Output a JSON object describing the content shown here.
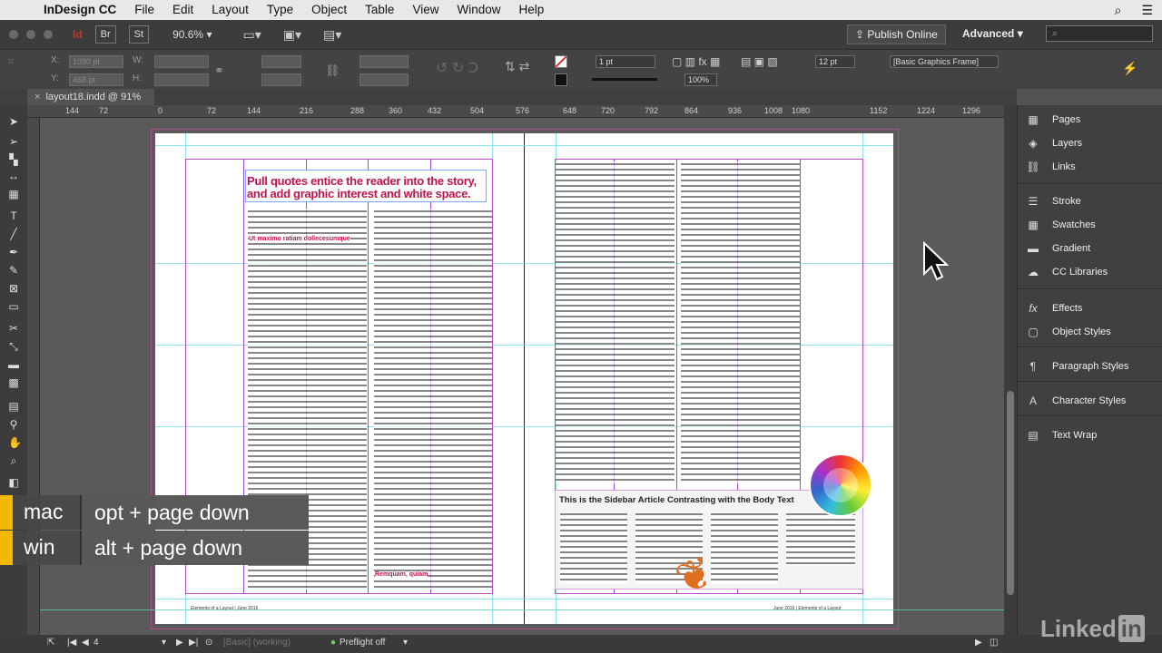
{
  "menubar": {
    "app_name": "InDesign CC",
    "items": [
      "File",
      "Edit",
      "Layout",
      "Type",
      "Object",
      "Table",
      "View",
      "Window",
      "Help"
    ]
  },
  "appbar": {
    "br_label": "Br",
    "st_label": "St",
    "zoom": "90.6%",
    "publish_label": "Publish Online",
    "workspace_label": "Advanced"
  },
  "control": {
    "x_value": "1090 pt",
    "y_value": "468 pt",
    "stroke_weight": "1 pt",
    "zoom_percent": "100%",
    "size_value": "12 pt",
    "frame_style": "[Basic Graphics Frame]"
  },
  "document": {
    "tab_title": "layout18.indd @ 91%"
  },
  "ruler": {
    "ticks": [
      "144",
      "72",
      "0",
      "72",
      "144",
      "216",
      "288",
      "360",
      "432",
      "504",
      "576",
      "648",
      "720",
      "792",
      "864",
      "936",
      "1008",
      "1080",
      "1152",
      "1224",
      "1296"
    ]
  },
  "spread": {
    "pull_quote": "Pull quotes entice the reader into the story, and add graphic interest and white space.",
    "subhead_1": "Ut maximo ratiam dollecesumque",
    "subhead_2": "Remquam, quiam",
    "sidebar_title": "This is the Sidebar Article Contrasting with the Body Text",
    "footer_left": "Elements of a Layout | June 2016",
    "footer_right": "June 2016 | Elements of a Layout"
  },
  "panels": {
    "items": [
      "Pages",
      "Layers",
      "Links",
      "Stroke",
      "Swatches",
      "Gradient",
      "CC Libraries",
      "Effects",
      "Object Styles",
      "Paragraph Styles",
      "Character Styles",
      "Text Wrap"
    ]
  },
  "statusbar": {
    "page_number": "4",
    "style_label": "[Basic] (working)",
    "preflight": "Preflight off"
  },
  "shortcuts": [
    {
      "os": "mac",
      "keys": "opt + page down"
    },
    {
      "os": "win",
      "keys": "alt + page down"
    }
  ],
  "watermark": {
    "text": "Linked",
    "badge": "in"
  },
  "colors": {
    "accent": "#c0144a",
    "guide_cyan": "#6fe0e6",
    "margin_magenta": "#c04bc9",
    "shortcut_yellow": "#f5b800"
  }
}
